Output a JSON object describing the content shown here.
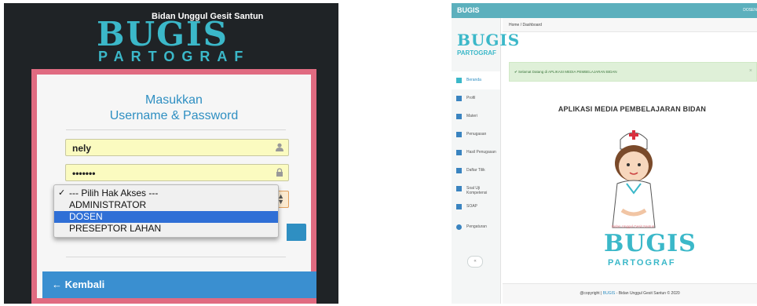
{
  "login": {
    "logo": {
      "tagline": "Bidan Unggul Gesit Santun",
      "word": "BUGIS",
      "sub": "PARTOGRAF"
    },
    "title_line1": "Masukkan",
    "title_line2": "Username & Password",
    "username_value": "nely",
    "password_value": "•••••••",
    "role_options": [
      "--- Pilih Hak Akses ---",
      "ADMINISTRATOR",
      "DOSEN",
      "PRESEPTOR LAHAN"
    ],
    "role_checked_index": 0,
    "role_highlighted_index": 2,
    "back_label": "← Kembali",
    "colors": {
      "accent": "#2f8fc2",
      "frame": "#e06b81",
      "panel": "#1f2326",
      "input": "#fbfbc0"
    }
  },
  "dashboard": {
    "app_title": "BUGIS",
    "user_label": "DOSEN",
    "breadcrumb": "Home / Dashboard",
    "logo": {
      "tagline": "Bidan Unggul Gesit Santun",
      "word": "BUGIS",
      "sub": "PARTOGRAF"
    },
    "nav": [
      {
        "label": "Beranda",
        "active": true
      },
      {
        "label": "Profil"
      },
      {
        "label": "Materi"
      },
      {
        "label": "Penugasan"
      },
      {
        "label": "Hasil Penugasan"
      },
      {
        "label": "Daftar Tilik"
      },
      {
        "label": "Soal Uji Kompetensi"
      },
      {
        "label": "SOAP"
      },
      {
        "label": "Pengaturan"
      }
    ],
    "alert_text": "✔ Selamat Datang di APLIKASI MEDIA PEMBELAJARAN BIDAN",
    "alert_close": "×",
    "headline": "APLIKASI MEDIA PEMBELAJARAN BIDAN",
    "footer_prefix": "@copyright | ",
    "footer_brand": "BUGIS",
    "footer_suffix": " - Bidan Unggul Gesit Santun © 2020",
    "colors": {
      "topbar": "#5cb0bd",
      "alert_bg": "#dff0d8",
      "alert_text": "#3c763d"
    }
  }
}
